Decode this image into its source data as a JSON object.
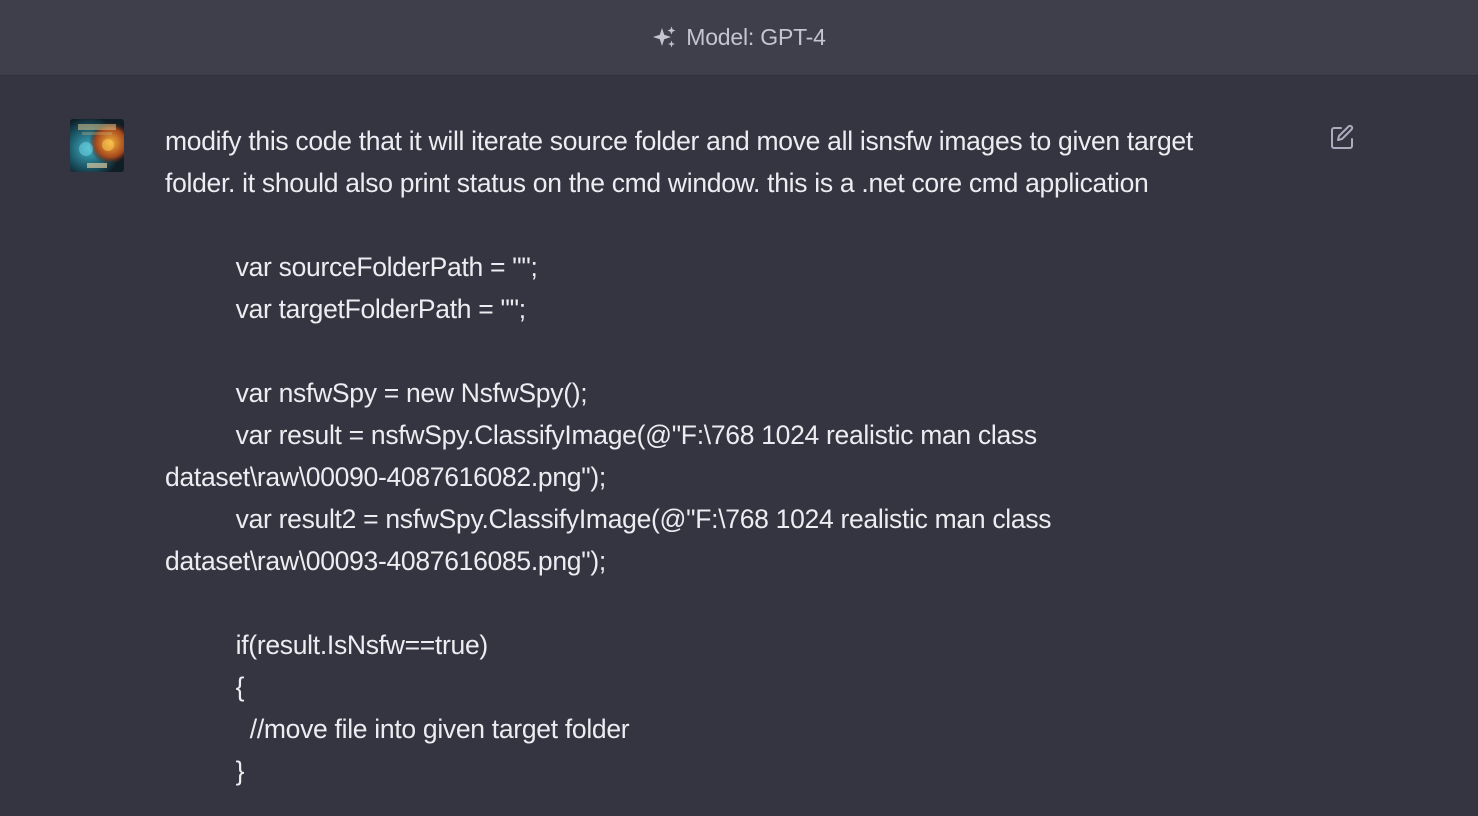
{
  "header": {
    "model_label": "Model: GPT-4",
    "icon": "sparkle-icon"
  },
  "message": {
    "avatar_icon": "user-avatar",
    "edit_icon": "edit-icon",
    "text": "modify this code that it will iterate source folder and move all isnsfw images to given target\nfolder. it should also print status on the cmd window. this is a .net core cmd application\n\n          var sourceFolderPath = \"\";\n          var targetFolderPath = \"\";\n\n          var nsfwSpy = new NsfwSpy();\n          var result = nsfwSpy.ClassifyImage(@\"F:\\768 1024 realistic man class\ndataset\\raw\\00090-4087616082.png\");\n          var result2 = nsfwSpy.ClassifyImage(@\"F:\\768 1024 realistic man class\ndataset\\raw\\00093-4087616085.png\");\n\n          if(result.IsNsfw==true)\n          {\n            //move file into given target folder\n          }"
  },
  "colors": {
    "background": "#343541",
    "header_background": "#3e3f4b",
    "text": "#ececf1",
    "muted_text": "#c5c5d2"
  }
}
